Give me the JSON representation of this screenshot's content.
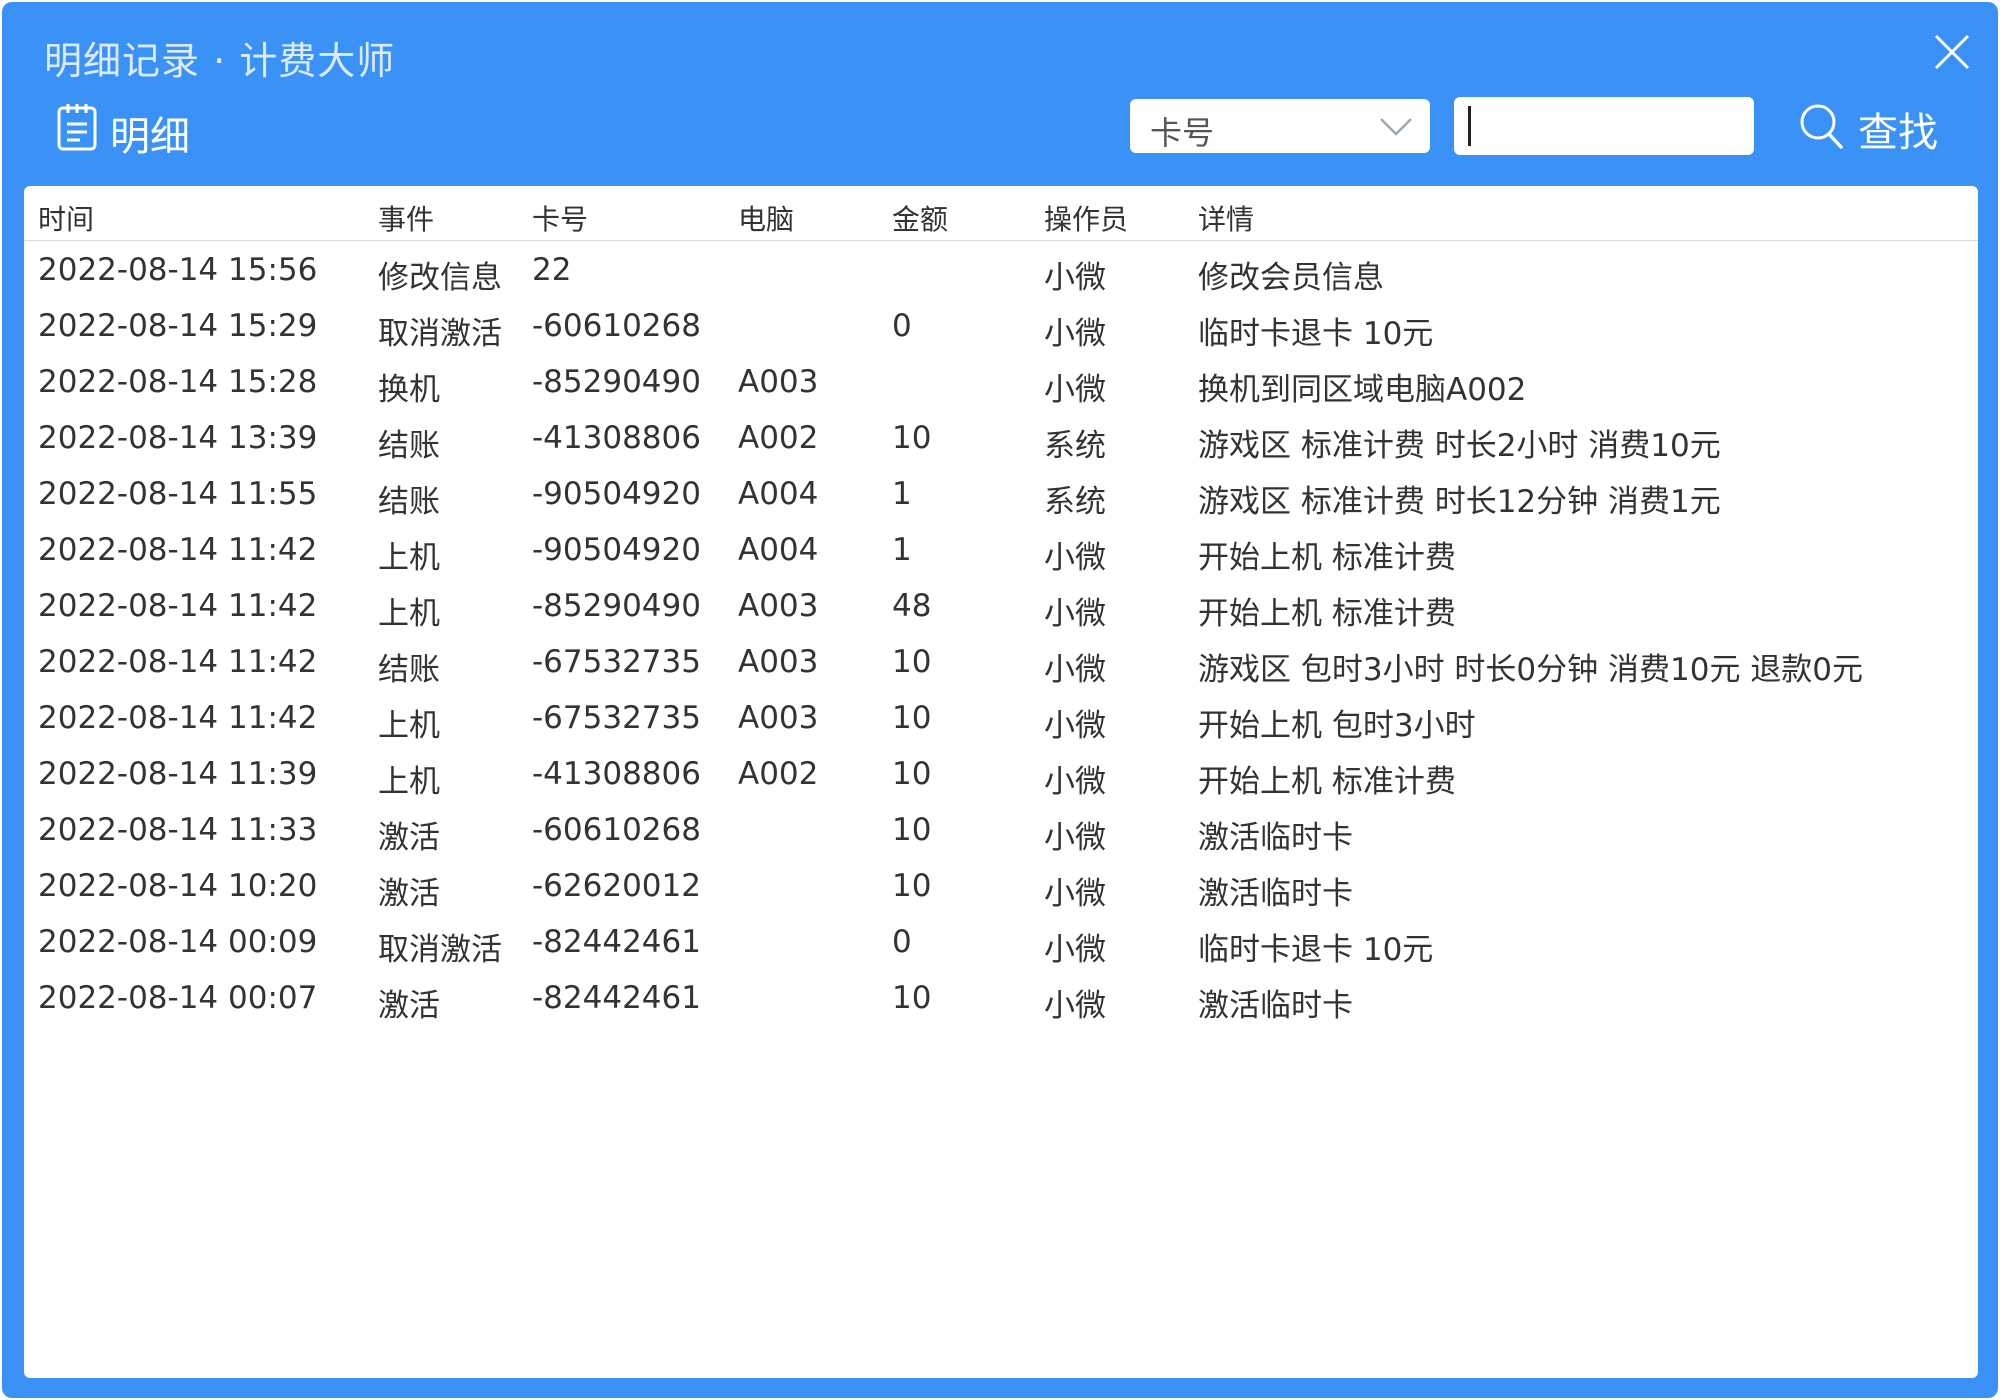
{
  "window": {
    "title": "明细记录 · 计费大师"
  },
  "toolbar": {
    "label": "明细",
    "filter_selected": "卡号",
    "search_value": "",
    "search_label": "查找"
  },
  "table": {
    "headers": [
      "时间",
      "事件",
      "卡号",
      "电脑",
      "金额",
      "操作员",
      "详情"
    ],
    "rows": [
      [
        "2022-08-14 15:56",
        "修改信息",
        "22",
        "",
        "",
        "小微",
        "修改会员信息"
      ],
      [
        "2022-08-14 15:29",
        "取消激活",
        "-60610268",
        "",
        "0",
        "小微",
        "临时卡退卡 10元"
      ],
      [
        "2022-08-14 15:28",
        "换机",
        "-85290490",
        "A003",
        "",
        "小微",
        "换机到同区域电脑A002"
      ],
      [
        "2022-08-14 13:39",
        "结账",
        "-41308806",
        "A002",
        "10",
        "系统",
        "游戏区 标准计费 时长2小时 消费10元"
      ],
      [
        "2022-08-14 11:55",
        "结账",
        "-90504920",
        "A004",
        "1",
        "系统",
        "游戏区 标准计费 时长12分钟 消费1元"
      ],
      [
        "2022-08-14 11:42",
        "上机",
        "-90504920",
        "A004",
        "1",
        "小微",
        "开始上机 标准计费"
      ],
      [
        "2022-08-14 11:42",
        "上机",
        "-85290490",
        "A003",
        "48",
        "小微",
        "开始上机 标准计费"
      ],
      [
        "2022-08-14 11:42",
        "结账",
        "-67532735",
        "A003",
        "10",
        "小微",
        "游戏区 包时3小时 时长0分钟 消费10元 退款0元"
      ],
      [
        "2022-08-14 11:42",
        "上机",
        "-67532735",
        "A003",
        "10",
        "小微",
        "开始上机 包时3小时"
      ],
      [
        "2022-08-14 11:39",
        "上机",
        "-41308806",
        "A002",
        "10",
        "小微",
        "开始上机 标准计费"
      ],
      [
        "2022-08-14 11:33",
        "激活",
        "-60610268",
        "",
        "10",
        "小微",
        "激活临时卡"
      ],
      [
        "2022-08-14 10:20",
        "激活",
        "-62620012",
        "",
        "10",
        "小微",
        "激活临时卡"
      ],
      [
        "2022-08-14 00:09",
        "取消激活",
        "-82442461",
        "",
        "0",
        "小微",
        "临时卡退卡 10元"
      ],
      [
        "2022-08-14 00:07",
        "激活",
        "-82442461",
        "",
        "10",
        "小微",
        "激活临时卡"
      ]
    ]
  }
}
